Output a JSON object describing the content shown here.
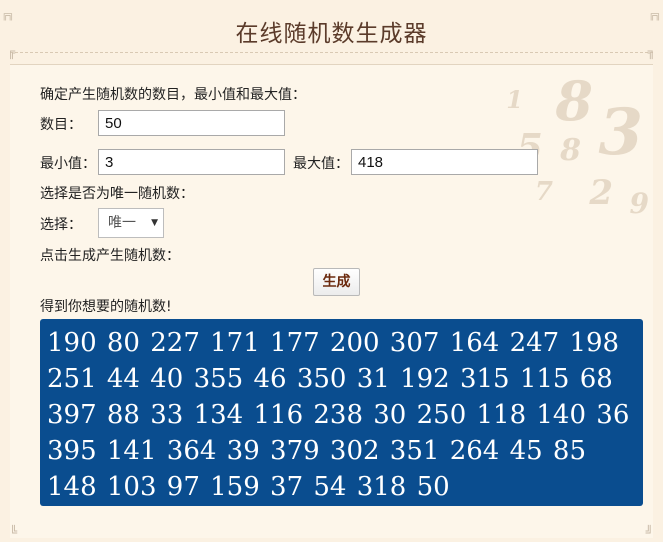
{
  "header": {
    "title": "在线随机数生成器"
  },
  "form": {
    "intro_label": "确定产生随机数的数目，最小值和最大值：",
    "count_label": "数目：",
    "count_value": "50",
    "min_label": "最小值：",
    "min_value": "3",
    "max_label": "最大值：",
    "max_value": "418",
    "unique_intro_label": "选择是否为唯一随机数：",
    "select_label": "选择：",
    "select_value": "唯一",
    "generate_intro_label": "点击生成产生随机数：",
    "generate_button_label": "生成",
    "result_label": "得到你想要的随机数!"
  },
  "result": {
    "numbers": "190 80 227 171 177 200 307 164 247 198 251 44 40 355 46 350 31 192 315 115 68 397 88 33 134 116 238 30 250 118 140 36 395 141 364 39 379 302 351 264 45 85 148 103 97 159 37 54 318 50"
  },
  "colors": {
    "page_background": "#fbf1e2",
    "title_color": "#5b3b2a",
    "result_background": "#0a4d8f",
    "result_text": "#ffffff",
    "button_text": "#6b2a0e"
  }
}
